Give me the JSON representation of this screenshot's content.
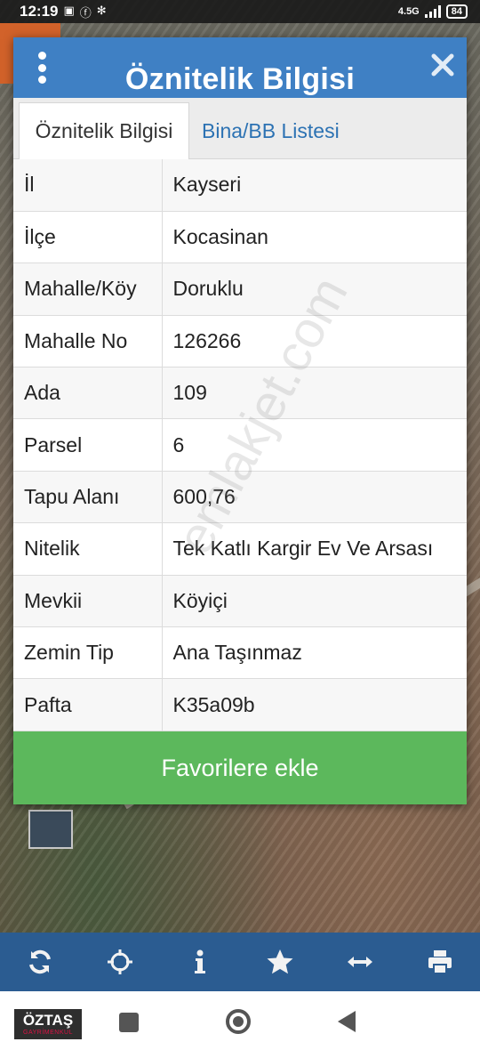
{
  "status_bar": {
    "time": "12:19",
    "network": "4.5G",
    "battery": "84"
  },
  "dialog": {
    "title": "Öznitelik Bilgisi",
    "tabs": [
      {
        "label": "Öznitelik Bilgisi",
        "active": true
      },
      {
        "label": "Bina/BB Listesi",
        "active": false
      }
    ],
    "rows": [
      {
        "key": "İl",
        "value": "Kayseri"
      },
      {
        "key": "İlçe",
        "value": "Kocasinan"
      },
      {
        "key": "Mahalle/Köy",
        "value": "Doruklu"
      },
      {
        "key": "Mahalle No",
        "value": "126266"
      },
      {
        "key": "Ada",
        "value": "109"
      },
      {
        "key": "Parsel",
        "value": "6"
      },
      {
        "key": "Tapu Alanı",
        "value": "600,76"
      },
      {
        "key": "Nitelik",
        "value": "Tek Katlı Kargir Ev Ve Arsası"
      },
      {
        "key": "Mevkii",
        "value": "Köyiçi"
      },
      {
        "key": "Zemin Tip",
        "value": "Ana Taşınmaz"
      },
      {
        "key": "Pafta",
        "value": "K35a09b"
      }
    ],
    "favorite_button": "Favorilere ekle"
  },
  "watermark": "emlakjet.com",
  "toolbar": {
    "icons": [
      "refresh-icon",
      "crosshair-icon",
      "info-icon",
      "star-icon",
      "measure-icon",
      "print-icon"
    ]
  },
  "logo": {
    "text": "ÖZTAŞ",
    "subtext": "GAYRİMENKUL"
  },
  "colors": {
    "header": "#3f80c4",
    "tab_link": "#2c72b3",
    "button": "#5cb85c",
    "toolbar": "#2b5c91"
  }
}
